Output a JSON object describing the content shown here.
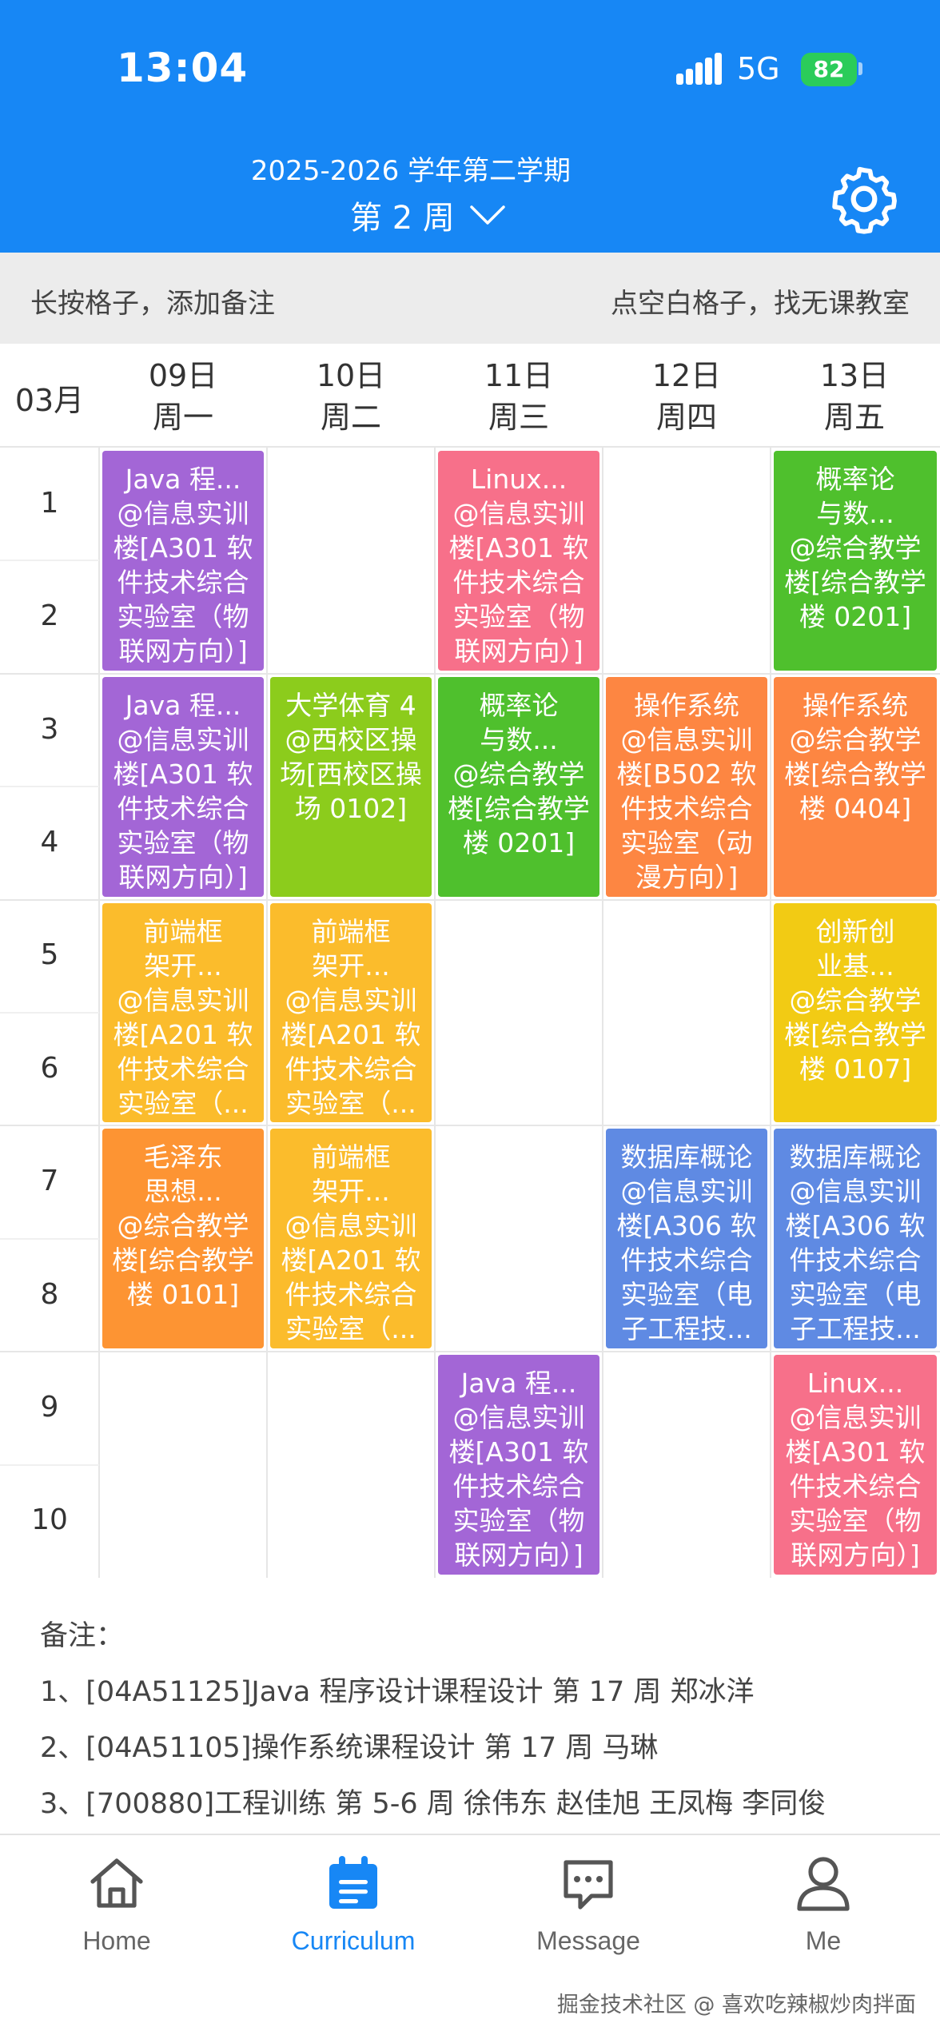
{
  "status_bar": {
    "time": "13:04",
    "network": "5G",
    "battery": "82"
  },
  "header": {
    "semester": "2025-2026 学年第二学期",
    "week": "第 2 周"
  },
  "tips": {
    "left": "长按格子，添加备注",
    "right": "点空白格子，找无课教室"
  },
  "month": "03月",
  "days": [
    {
      "date": "09日",
      "weekday": "周一"
    },
    {
      "date": "10日",
      "weekday": "周二"
    },
    {
      "date": "11日",
      "weekday": "周三"
    },
    {
      "date": "12日",
      "weekday": "周四"
    },
    {
      "date": "13日",
      "weekday": "周五"
    }
  ],
  "periods": [
    "1",
    "2",
    "3",
    "4",
    "5",
    "6",
    "7",
    "8",
    "9",
    "10"
  ],
  "courses": [
    {
      "day": 0,
      "start": 1,
      "span": 2,
      "color": "#a366d6",
      "lines": [
        "Java 程...",
        "@信息实训",
        "楼[A301 软",
        "件技术综合",
        "实验室（物",
        "联网方向）]"
      ]
    },
    {
      "day": 2,
      "start": 1,
      "span": 2,
      "color": "#f7708a",
      "lines": [
        "Linux...",
        "@信息实训",
        "楼[A301 软",
        "件技术综合",
        "实验室（物",
        "联网方向）]"
      ]
    },
    {
      "day": 4,
      "start": 1,
      "span": 2,
      "color": "#4fc02d",
      "lines": [
        "概率论",
        "与数...",
        "@综合教学",
        "楼[综合教学",
        "楼 0201]"
      ]
    },
    {
      "day": 0,
      "start": 3,
      "span": 2,
      "color": "#a366d6",
      "lines": [
        "Java 程...",
        "@信息实训",
        "楼[A301 软",
        "件技术综合",
        "实验室（物",
        "联网方向）]"
      ]
    },
    {
      "day": 1,
      "start": 3,
      "span": 2,
      "color": "#8ccc1c",
      "lines": [
        "大学体育 4",
        "@西校区操",
        "场[西校区操",
        "场 0102]"
      ]
    },
    {
      "day": 2,
      "start": 3,
      "span": 2,
      "color": "#4fc02d",
      "lines": [
        "概率论",
        "与数...",
        "@综合教学",
        "楼[综合教学",
        "楼 0201]"
      ]
    },
    {
      "day": 3,
      "start": 3,
      "span": 2,
      "color": "#fd8642",
      "lines": [
        "操作系统",
        "@信息实训",
        "楼[B502 软",
        "件技术综合",
        "实验室（动",
        "漫方向）]"
      ]
    },
    {
      "day": 4,
      "start": 3,
      "span": 2,
      "color": "#fd8642",
      "lines": [
        "操作系统",
        "@综合教学",
        "楼[综合教学",
        "楼 0404]"
      ]
    },
    {
      "day": 0,
      "start": 5,
      "span": 2,
      "color": "#fbbc2c",
      "lines": [
        "前端框",
        "架开...",
        "@信息实训",
        "楼[A201 软",
        "件技术综合",
        "实验室（..."
      ]
    },
    {
      "day": 1,
      "start": 5,
      "span": 2,
      "color": "#fbbc2c",
      "lines": [
        "前端框",
        "架开...",
        "@信息实训",
        "楼[A201 软",
        "件技术综合",
        "实验室（..."
      ]
    },
    {
      "day": 4,
      "start": 5,
      "span": 2,
      "color": "#f2cb14",
      "lines": [
        "创新创",
        "业基...",
        "@综合教学",
        "楼[综合教学",
        "楼 0107]"
      ]
    },
    {
      "day": 0,
      "start": 7,
      "span": 2,
      "color": "#fd9433",
      "lines": [
        "毛泽东",
        "思想...",
        "@综合教学",
        "楼[综合教学",
        "楼 0101]"
      ]
    },
    {
      "day": 1,
      "start": 7,
      "span": 2,
      "color": "#fbbc2c",
      "lines": [
        "前端框",
        "架开...",
        "@信息实训",
        "楼[A201 软",
        "件技术综合",
        "实验室（..."
      ]
    },
    {
      "day": 3,
      "start": 7,
      "span": 2,
      "color": "#5f8ae3",
      "lines": [
        "数据库概论",
        "@信息实训",
        "楼[A306 软",
        "件技术综合",
        "实验室（电",
        "子工程技..."
      ]
    },
    {
      "day": 4,
      "start": 7,
      "span": 2,
      "color": "#5f8ae3",
      "lines": [
        "数据库概论",
        "@信息实训",
        "楼[A306 软",
        "件技术综合",
        "实验室（电",
        "子工程技..."
      ]
    },
    {
      "day": 2,
      "start": 9,
      "span": 2,
      "color": "#a366d6",
      "lines": [
        "Java 程...",
        "@信息实训",
        "楼[A301 软",
        "件技术综合",
        "实验室（物",
        "联网方向）]"
      ]
    },
    {
      "day": 4,
      "start": 9,
      "span": 2,
      "color": "#f7708a",
      "lines": [
        "Linux...",
        "@信息实训",
        "楼[A301 软",
        "件技术综合",
        "实验室（物",
        "联网方向）]"
      ]
    }
  ],
  "notes": {
    "title": "备注：",
    "items": [
      "1、[04A51125]Java 程序设计课程设计 第 17 周 郑冰洋",
      "2、[04A51105]操作系统课程设计 第 17 周 马琳",
      "3、[700880]工程训练 第 5-6 周 徐伟东 赵佳旭 王凤梅 李同俊"
    ]
  },
  "tabs": [
    {
      "label": "Home",
      "icon": "home-icon"
    },
    {
      "label": "Curriculum",
      "icon": "calendar-icon"
    },
    {
      "label": "Message",
      "icon": "message-icon"
    },
    {
      "label": "Me",
      "icon": "user-icon"
    }
  ],
  "watermark": "掘金技术社区 @ 喜欢吃辣椒炒肉拌面",
  "colors": {
    "primary": "#1787f5",
    "battery": "#2bcc5a"
  }
}
